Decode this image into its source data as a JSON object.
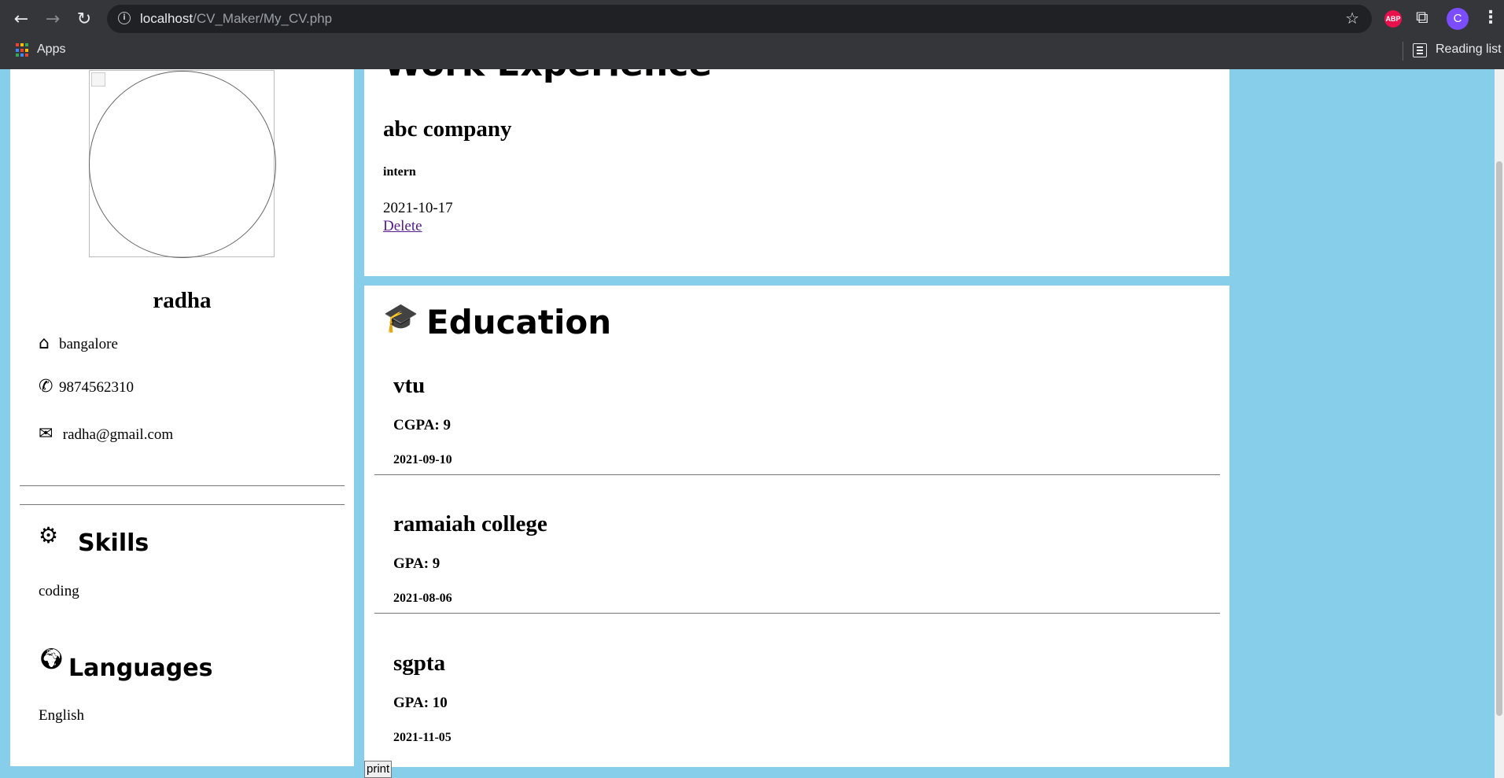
{
  "browser": {
    "url_host": "localhost",
    "url_path": "/CV_Maker/My_CV.php",
    "abp_label": "ABP",
    "avatar_letter": "C",
    "bookmarks_apps": "Apps",
    "reading_list": "Reading list",
    "apps_colors": [
      "#ea4335",
      "#fbbc05",
      "#34a853",
      "#4285f4",
      "#ea4335",
      "#fbbc05",
      "#34a853",
      "#4285f4",
      "#ea4335"
    ]
  },
  "profile": {
    "name": "radha",
    "address": "bangalore",
    "phone": "9874562310",
    "email": "radha@gmail.com"
  },
  "skills": {
    "title": "Skills",
    "items": [
      "coding"
    ]
  },
  "languages": {
    "title": "Languages",
    "items": [
      "English"
    ]
  },
  "work": {
    "title": "Work Experience",
    "entries": [
      {
        "company": "abc company",
        "role": "intern",
        "date": "2021-10-17",
        "delete_label": "Delete"
      }
    ]
  },
  "education": {
    "title": "Education",
    "entries": [
      {
        "institution": "vtu",
        "grade": "CGPA: 9",
        "date": "2021-09-10"
      },
      {
        "institution": "ramaiah college",
        "grade": "GPA: 9",
        "date": "2021-08-06"
      },
      {
        "institution": "sgpta",
        "grade": "GPA: 10",
        "date": "2021-11-05"
      }
    ]
  },
  "actions": {
    "print_label": "print"
  },
  "colors": {
    "page_bg": "#87ceeb",
    "link": "#551a8b"
  }
}
